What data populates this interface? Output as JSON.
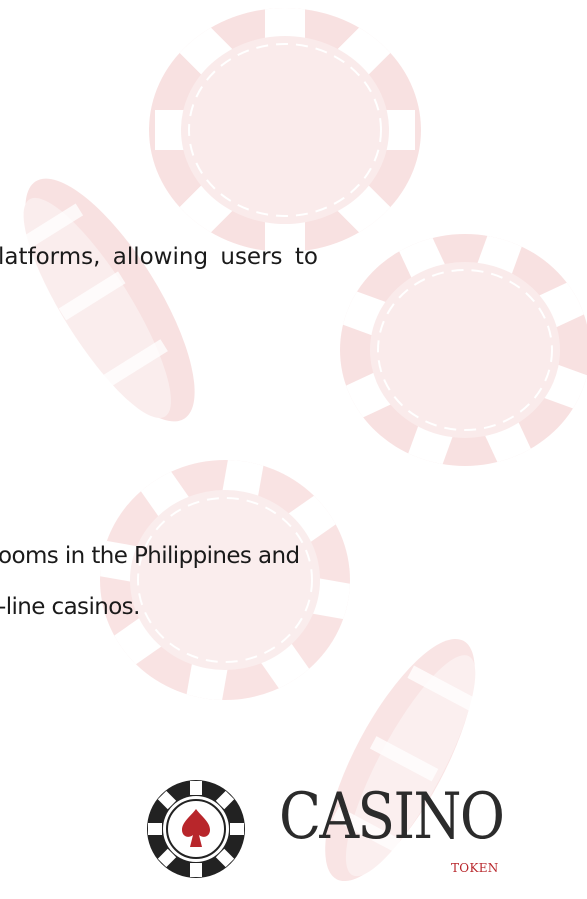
{
  "content": {
    "lines": [
      "latforms, allowing users to",
      "ooms in the Philippines and",
      "-line casinos."
    ]
  },
  "logo": {
    "word": "CASINO",
    "sub": "TOKEN"
  },
  "colors": {
    "chip_tint": "#f7dcdc",
    "brand_red": "#b8262b",
    "logo_dark": "#2b2b2b",
    "text": "#1a1a1a"
  }
}
